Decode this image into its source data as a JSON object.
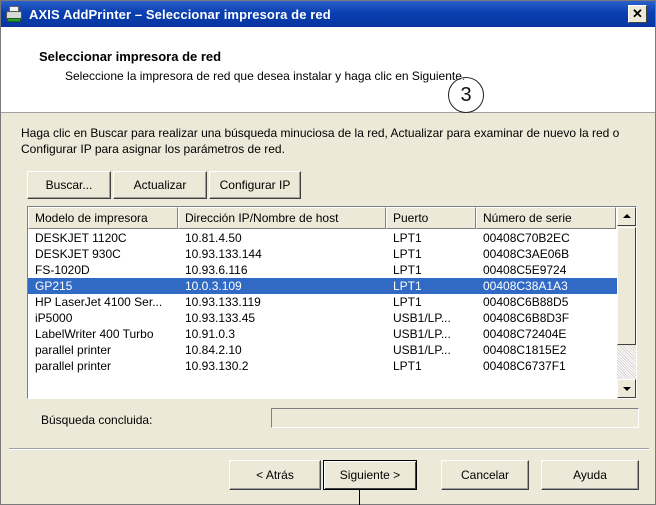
{
  "window": {
    "title": "AXIS AddPrinter – Seleccionar impresora de red",
    "close_label": "✕"
  },
  "header": {
    "title": "Seleccionar impresora de red",
    "subtitle": "Seleccione la impresora de red que desea instalar y haga clic en Siguiente.",
    "step_marker": "3"
  },
  "instructions": "Haga clic en Buscar para realizar una búsqueda minuciosa de la red, Actualizar para examinar de nuevo la red o Configurar IP para asignar los parámetros de red.",
  "toolbar": {
    "search_label": "Buscar...",
    "refresh_label": "Actualizar",
    "configure_label": "Configurar IP"
  },
  "printer_list": {
    "columns": [
      "Modelo de impresora",
      "Dirección IP/Nombre de host",
      "Puerto",
      "Número de serie"
    ],
    "rows": [
      [
        "DESKJET 1120C",
        "10.81.4.50",
        "LPT1",
        "00408C70B2EC"
      ],
      [
        "DESKJET 930C",
        "10.93.133.144",
        "LPT1",
        "00408C3AE06B"
      ],
      [
        "FS-1020D",
        "10.93.6.116",
        "LPT1",
        "00408C5E9724"
      ],
      [
        "GP215",
        "10.0.3.109",
        "LPT1",
        "00408C38A1A3"
      ],
      [
        "HP LaserJet 4100 Ser...",
        "10.93.133.119",
        "LPT1",
        "00408C6B88D5"
      ],
      [
        "iP5000",
        "10.93.133.45",
        "USB1/LP...",
        "00408C6B8D3F"
      ],
      [
        "LabelWriter 400 Turbo",
        "10.91.0.3",
        "USB1/LP...",
        "00408C72404E"
      ],
      [
        "parallel printer",
        "10.84.2.10",
        "USB1/LP...",
        "00408C1815E2"
      ],
      [
        "parallel printer",
        "10.93.130.2",
        "LPT1",
        "00408C6737F1"
      ]
    ],
    "selected_row": 3
  },
  "status": {
    "label": "Búsqueda concluida:",
    "progress": 0
  },
  "footer": {
    "back_label": "< Atrás",
    "next_label": "Siguiente >",
    "cancel_label": "Cancelar",
    "help_label": "Ayuda"
  },
  "colors": {
    "title_bar": "#0a3fb0",
    "selection": "#316ac5",
    "face": "#ece9d8"
  }
}
